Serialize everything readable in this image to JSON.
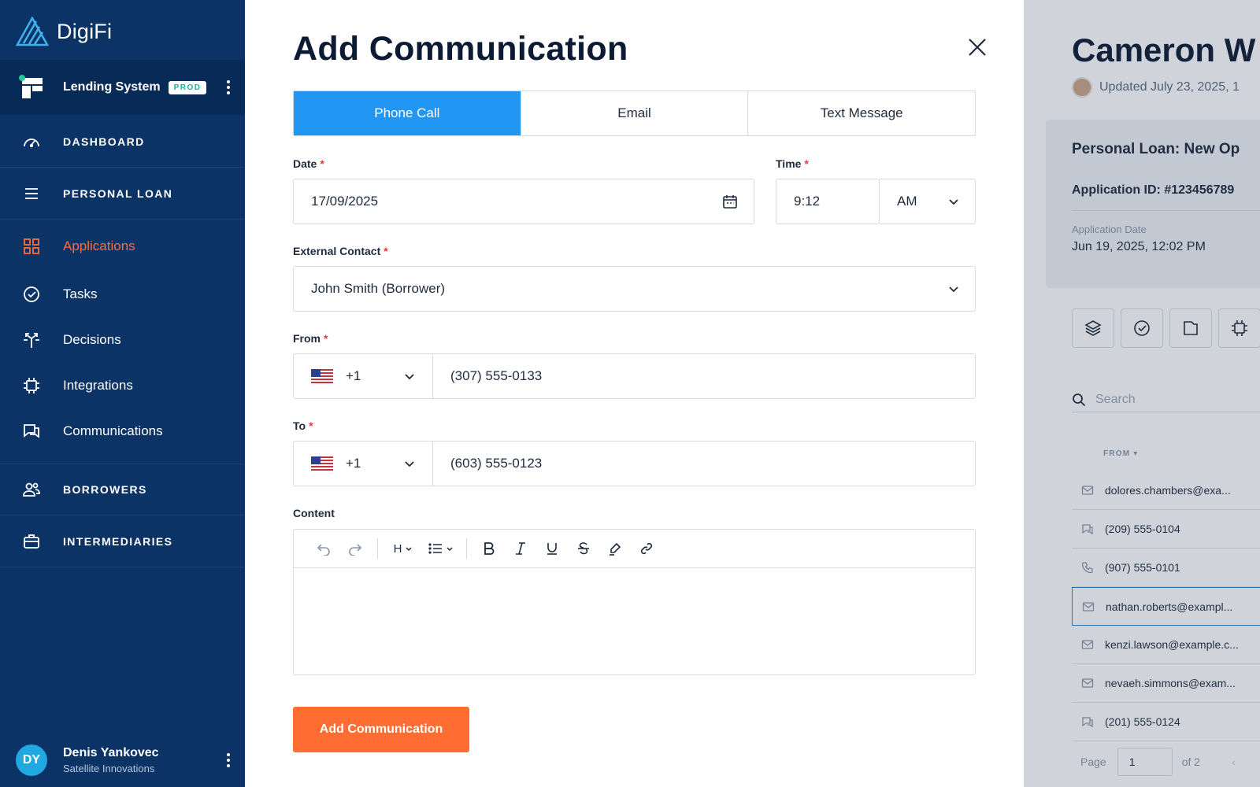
{
  "sidebar": {
    "logo_text": "DigiFi",
    "system_name": "Lending System",
    "system_badge": "PROD",
    "sections": {
      "dashboard": "DASHBOARD",
      "personal_loan": "PERSONAL LOAN",
      "borrowers": "BORROWERS",
      "intermediaries": "INTERMEDIARIES"
    },
    "items": [
      {
        "label": "Applications",
        "icon": "grid-icon",
        "active": true
      },
      {
        "label": "Tasks",
        "icon": "check-circle-icon"
      },
      {
        "label": "Decisions",
        "icon": "split-arrows-icon"
      },
      {
        "label": "Integrations",
        "icon": "chip-icon"
      },
      {
        "label": "Communications",
        "icon": "chat-icon"
      }
    ],
    "user": {
      "initials": "DY",
      "name": "Denis Yankovec",
      "org": "Satellite Innovations"
    }
  },
  "modal": {
    "title": "Add Communication",
    "tabs": [
      {
        "label": "Phone Call",
        "active": true
      },
      {
        "label": "Email"
      },
      {
        "label": "Text Message"
      }
    ],
    "date": {
      "label": "Date",
      "value": "17/09/2025"
    },
    "time": {
      "label": "Time",
      "value": "9:12",
      "period": "AM"
    },
    "contact": {
      "label": "External Contact",
      "value": "John Smith (Borrower)"
    },
    "from": {
      "label": "From",
      "country_code": "+1",
      "number": "(307) 555-0133"
    },
    "to": {
      "label": "To",
      "country_code": "+1",
      "number": "(603) 555-0123"
    },
    "content": {
      "label": "Content",
      "heading_button": "H"
    },
    "submit_label": "Add Communication",
    "accent_color": "#2196f3",
    "submit_color": "#ff6d33"
  },
  "background": {
    "title": "Cameron W",
    "updated": "Updated July 23, 2025, 1",
    "card": {
      "title": "Personal Loan: New Op",
      "application_id": "Application ID: #123456789",
      "date_label": "Application Date",
      "date_value": "Jun 19, 2025, 12:02 PM"
    },
    "search_placeholder": "Search",
    "column_header": "FROM",
    "rows": [
      {
        "type": "email",
        "from": "dolores.chambers@exa..."
      },
      {
        "type": "sms",
        "from": "(209) 555-0104"
      },
      {
        "type": "phone",
        "from": "(907) 555-0101"
      },
      {
        "type": "email",
        "from": "nathan.roberts@exampl...",
        "selected": true
      },
      {
        "type": "email",
        "from": "kenzi.lawson@example.c..."
      },
      {
        "type": "email",
        "from": "nevaeh.simmons@exam..."
      },
      {
        "type": "sms",
        "from": "(201) 555-0124"
      }
    ],
    "pager": {
      "page_label": "Page",
      "page": "1",
      "of": "of 2"
    }
  }
}
